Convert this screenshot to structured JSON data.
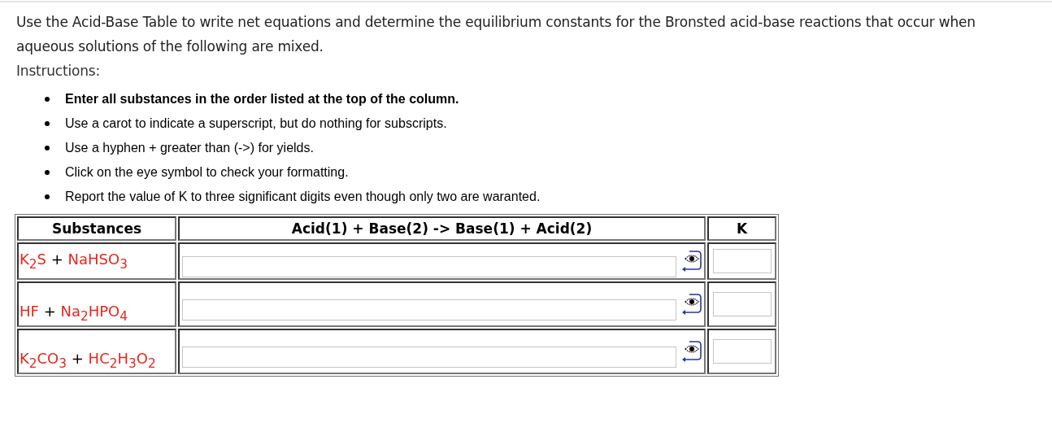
{
  "intro": "Use the Acid-Base Table to write net equations and determine the equilibrium constants for the Bronsted acid-base reactions that occur when aqueous solutions of the following are mixed.",
  "instructions_label": "Instructions:",
  "instructions": [
    {
      "text": "Enter all substances in the order listed at the top of the column.",
      "bold": true
    },
    {
      "text": "Use a carot to indicate a superscript, but do nothing for subscripts.",
      "bold": false
    },
    {
      "text": "Use a hyphen + greater than (->) for yields.",
      "bold": false
    },
    {
      "text": "Click on the eye symbol to check your formatting.",
      "bold": false
    },
    {
      "text": "Report the value of K to three significant digits even though only two are waranted.",
      "bold": false
    }
  ],
  "table": {
    "columns": [
      "Substances",
      "Acid(1) + Base(2) -> Base(1) + Acid(2)",
      "K"
    ],
    "rows": [
      {
        "substances": [
          {
            "kind": "formula",
            "text": "K$_{2}$S"
          },
          {
            "kind": "operator",
            "text": "+"
          },
          {
            "kind": "formula",
            "text": "NaHSO$_{3}$"
          }
        ]
      },
      {
        "substances": [
          {
            "kind": "formula",
            "text": "HF"
          },
          {
            "kind": "operator",
            "text": "+"
          },
          {
            "kind": "formula",
            "text": "Na$_{2}$HPO$_{4}$"
          }
        ]
      },
      {
        "substances": [
          {
            "kind": "formula",
            "text": "K$_{2}$CO$_{3}$"
          },
          {
            "kind": "operator",
            "text": "+"
          },
          {
            "kind": "formula",
            "text": "HC$_{2}$H$_{3}$O$_{2}$"
          }
        ]
      }
    ]
  }
}
